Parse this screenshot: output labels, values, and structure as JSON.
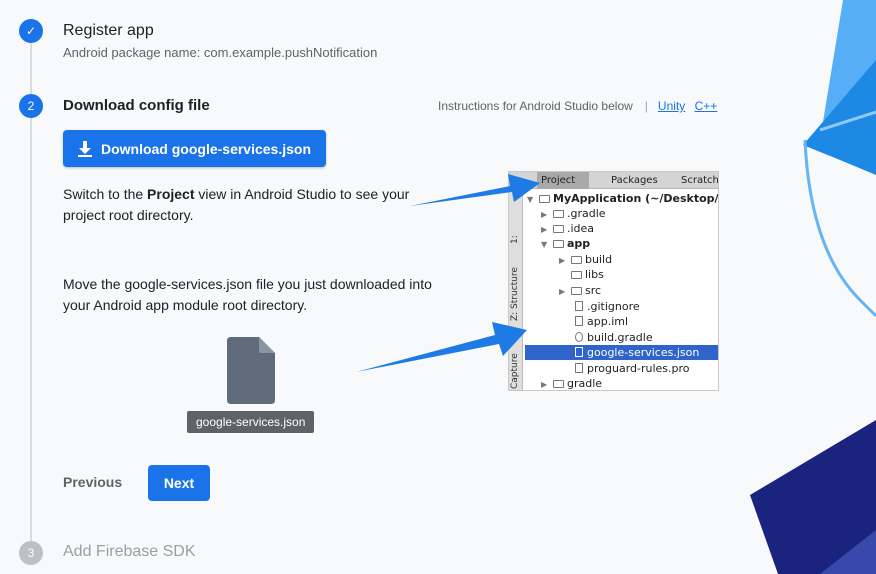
{
  "steps": {
    "step1": {
      "number": "✓",
      "title": "Register app",
      "subtitle": "Android package name: com.example.pushNotification"
    },
    "step2": {
      "number": "2",
      "title": "Download config file"
    },
    "step3": {
      "number": "3",
      "title": "Add Firebase SDK"
    }
  },
  "instructions": {
    "label": "Instructions for Android Studio below",
    "separator": "|",
    "links": [
      "Unity",
      "C++"
    ]
  },
  "download_button": {
    "label": "Download google-services.json",
    "icon": "download-icon"
  },
  "switch_text": {
    "pre": "Switch to the ",
    "bold": "Project",
    "post": " view in Android Studio to see your project root directory."
  },
  "move_text": "Move the google-services.json file you just downloaded into your Android app module root directory.",
  "file_card": {
    "label": "google-services.json",
    "icon": "file-icon"
  },
  "nav": {
    "previous": "Previous",
    "next": "Next"
  },
  "android_studio": {
    "tabs": [
      "Project",
      "Packages",
      "Scratche"
    ],
    "side_labels": [
      "1:",
      "Z: Structure",
      "Capture"
    ],
    "tree": [
      {
        "label": "MyApplication (~/Desktop/My"
      },
      {
        "label": ".gradle"
      },
      {
        "label": ".idea"
      },
      {
        "label": "app"
      },
      {
        "label": "build"
      },
      {
        "label": "libs"
      },
      {
        "label": "src"
      },
      {
        "label": ".gitignore"
      },
      {
        "label": "app.iml"
      },
      {
        "label": "build.gradle"
      },
      {
        "label": "google-services.json"
      },
      {
        "label": "proguard-rules.pro"
      },
      {
        "label": "gradle"
      }
    ]
  },
  "colors": {
    "primary": "#1a73e8",
    "pending": "#bdc1c6",
    "background": "#f8f9fa",
    "arrow": "#1e7be6"
  }
}
